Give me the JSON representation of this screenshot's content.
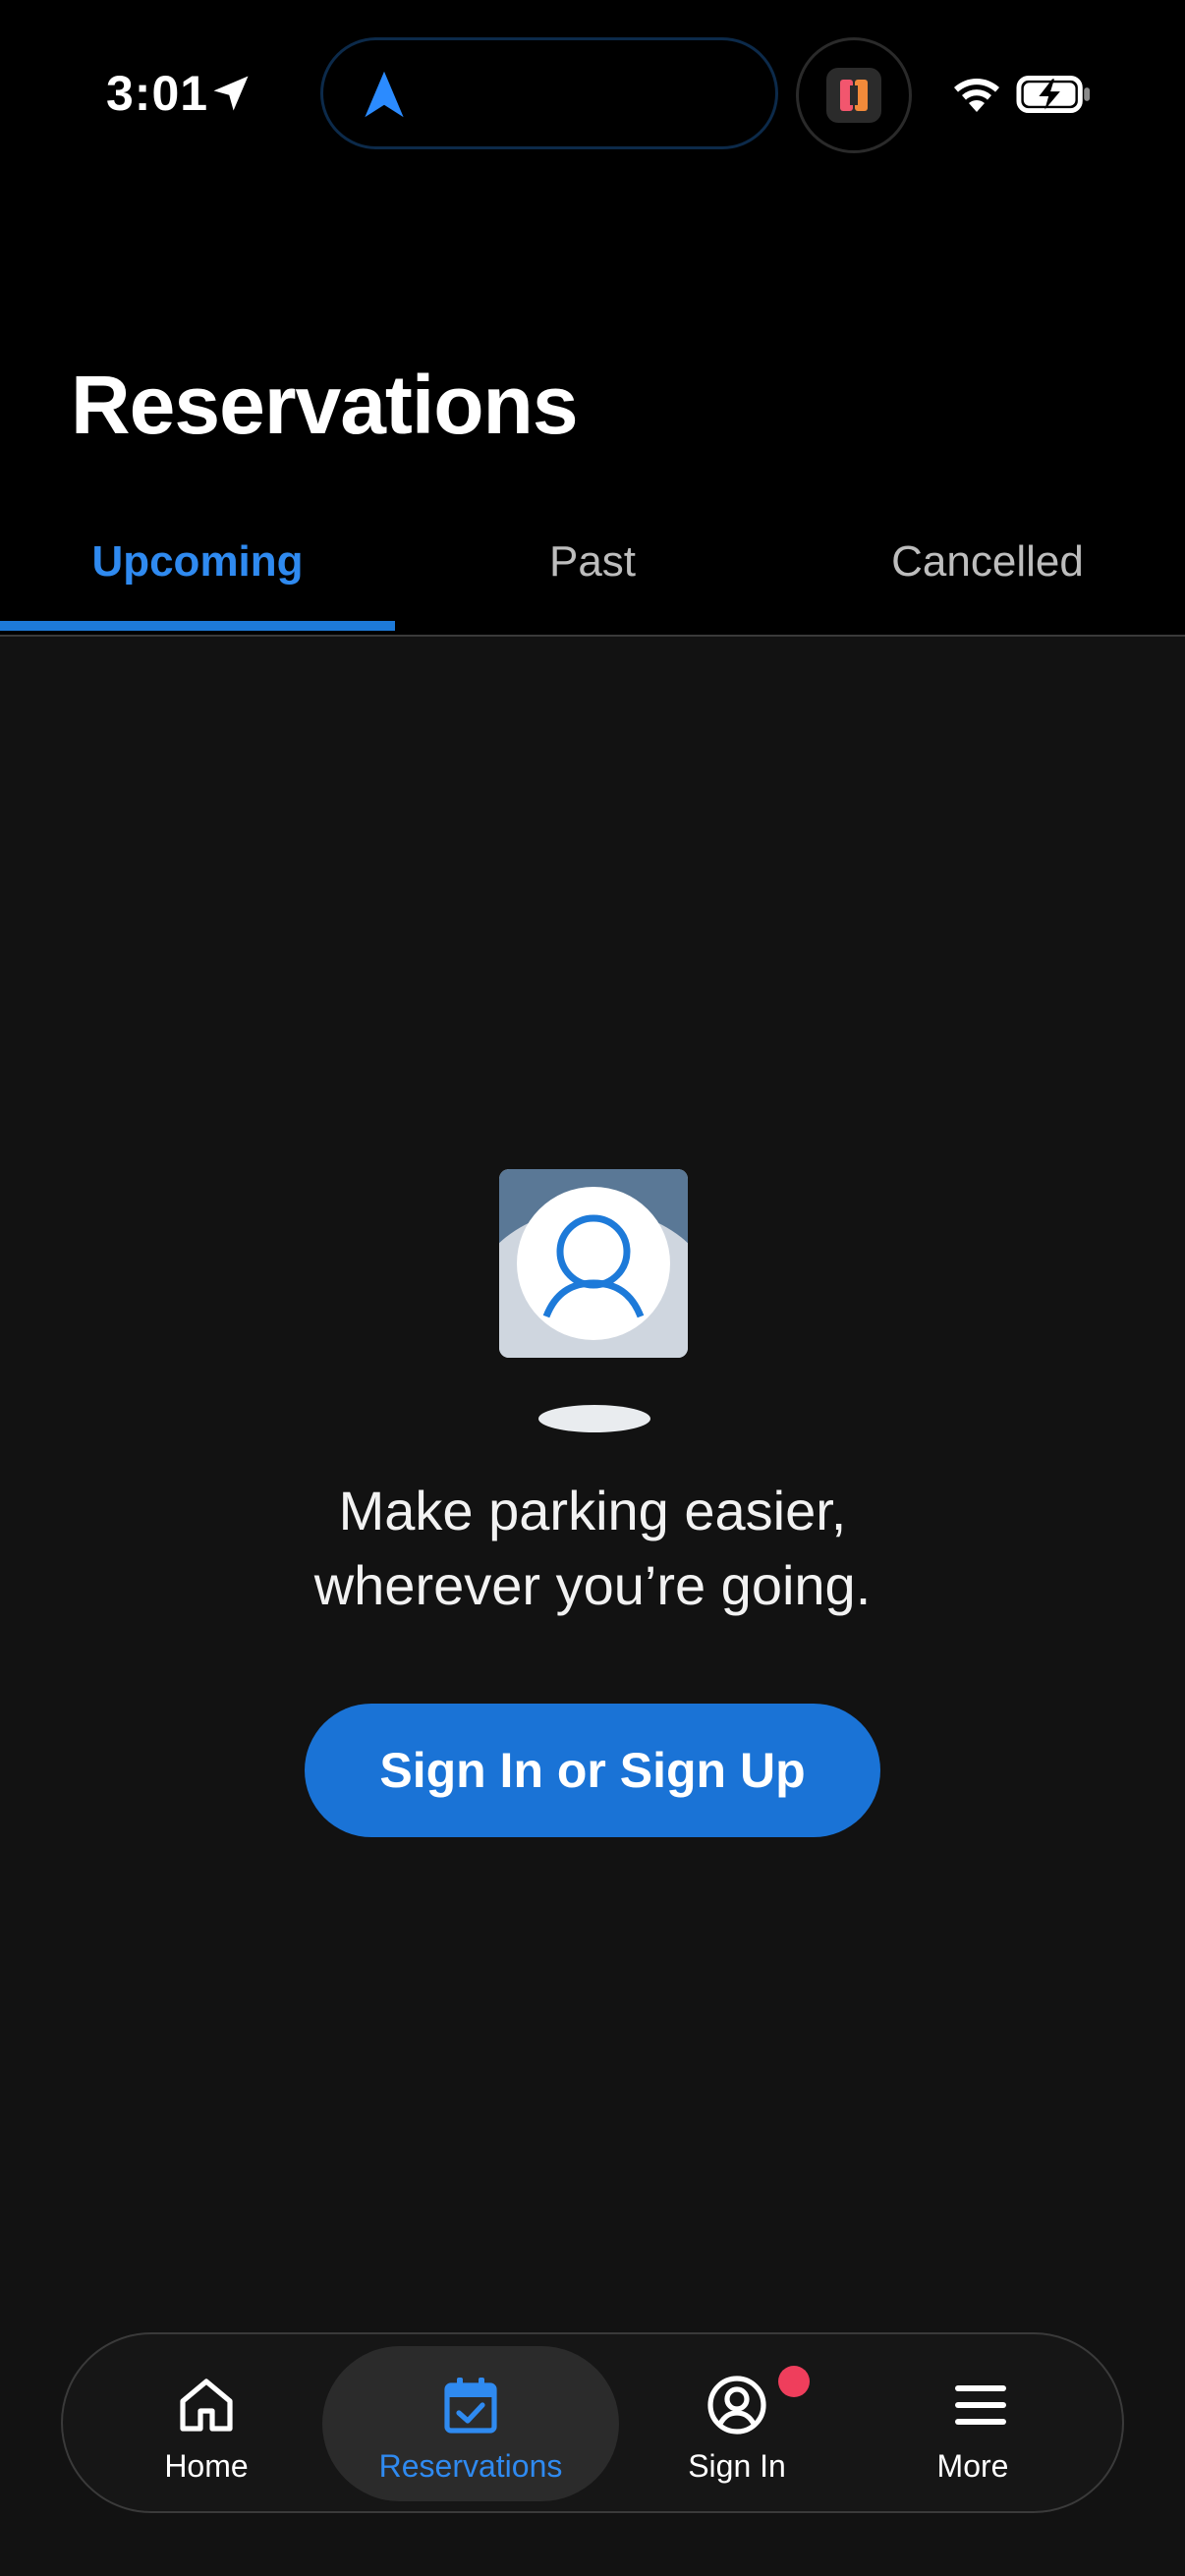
{
  "status_bar": {
    "time": "3:01",
    "icons": [
      "location-arrow-icon",
      "navigation-arrow-icon",
      "app-activity-icon",
      "wifi-icon",
      "battery-charging-icon"
    ]
  },
  "header": {
    "title": "Reservations"
  },
  "tabs": [
    {
      "label": "Upcoming",
      "active": true
    },
    {
      "label": "Past",
      "active": false
    },
    {
      "label": "Cancelled",
      "active": false
    }
  ],
  "empty_state": {
    "illustration": "user-avatar-icon",
    "line1": "Make parking easier,",
    "line2": "wherever you’re going.",
    "cta_label": "Sign In or Sign Up"
  },
  "bottom_nav": [
    {
      "label": "Home",
      "icon": "home-icon",
      "active": false
    },
    {
      "label": "Reservations",
      "icon": "calendar-check-icon",
      "active": true
    },
    {
      "label": "Sign In",
      "icon": "user-circle-icon",
      "active": false,
      "badge": true
    },
    {
      "label": "More",
      "icon": "menu-icon",
      "active": false
    }
  ],
  "colors": {
    "accent": "#1a73d6",
    "accent_text": "#2f8af0",
    "background": "#121212",
    "header_background": "#000000",
    "badge": "#ef3e5c"
  }
}
